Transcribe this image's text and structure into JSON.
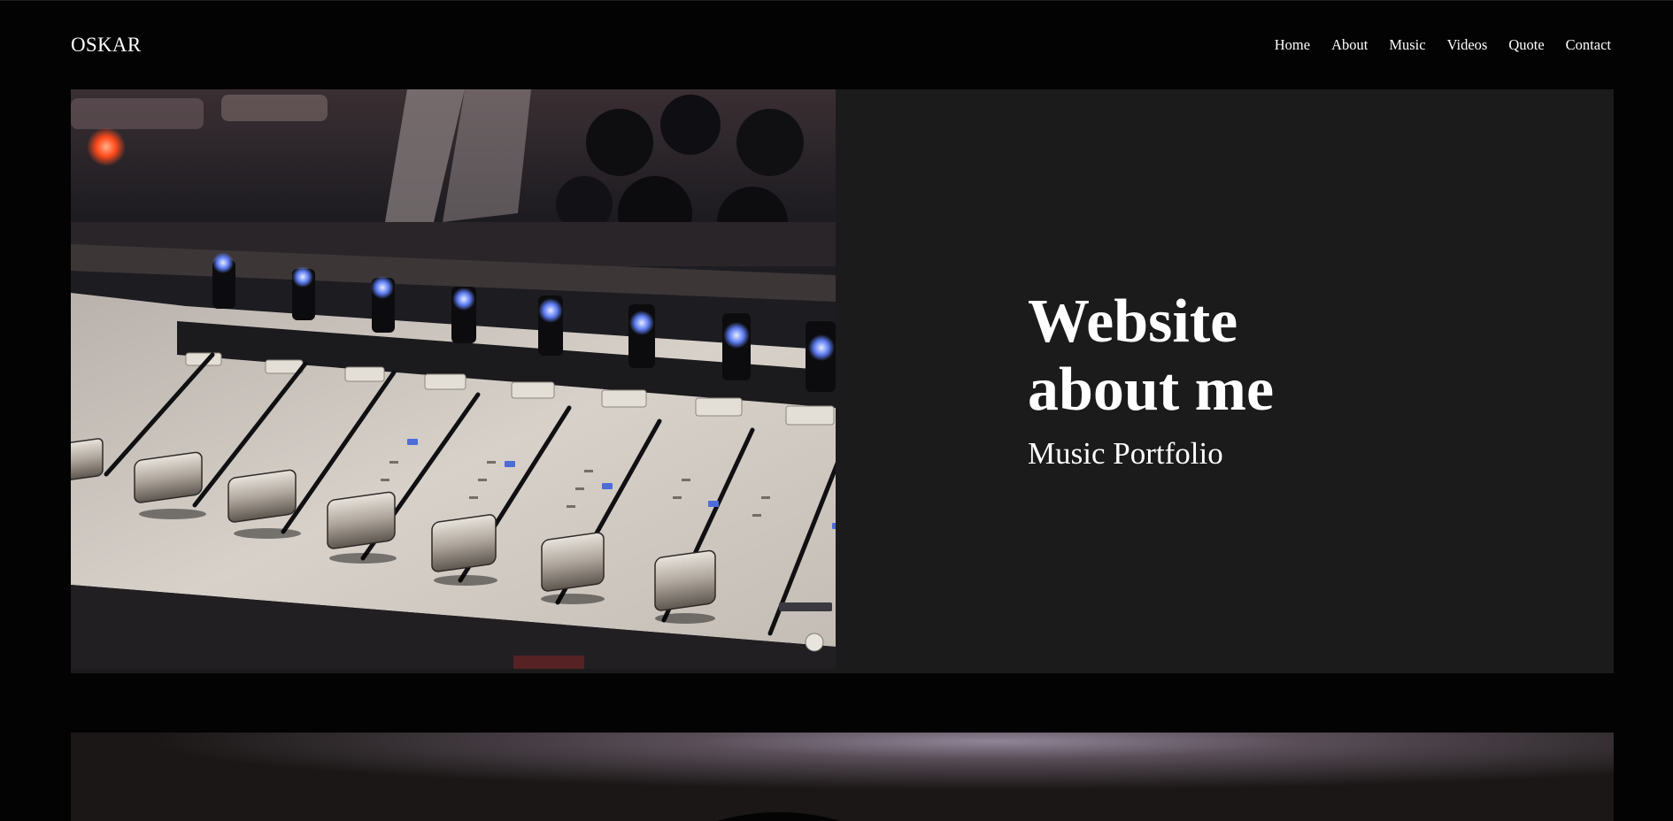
{
  "header": {
    "brand": "OSKAR",
    "nav": [
      {
        "label": "Home"
      },
      {
        "label": "About"
      },
      {
        "label": "Music"
      },
      {
        "label": "Videos"
      },
      {
        "label": "Quote"
      },
      {
        "label": "Contact"
      }
    ]
  },
  "hero": {
    "title_line1": "Website",
    "title_line2": "about me",
    "subtitle": "Music Portfolio",
    "image_subject": "mixing-console-faders"
  },
  "colors": {
    "page_background": "#030303",
    "hero_panel": "#1b1b1c",
    "text": "#ffffff"
  }
}
